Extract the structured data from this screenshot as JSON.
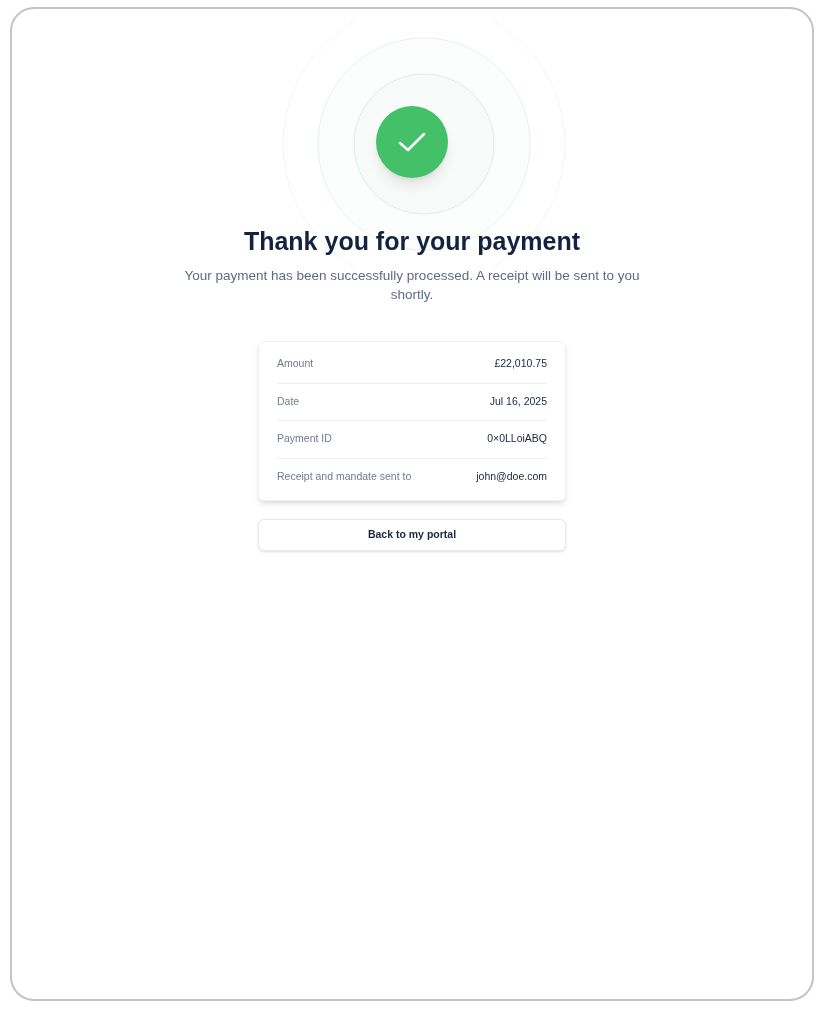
{
  "title": "Thank you for your payment",
  "message": "Your payment has been successfully processed. A receipt will be sent to you shortly.",
  "details": [
    {
      "label": "Amount",
      "value": "£22,010.75"
    },
    {
      "label": "Date",
      "value": "Jul 16, 2025"
    },
    {
      "label": "Payment ID",
      "value": "0×0LLoiABQ"
    },
    {
      "label": "Receipt and mandate sent to",
      "value": "john@doe.com"
    }
  ],
  "button": "Back to my portal"
}
